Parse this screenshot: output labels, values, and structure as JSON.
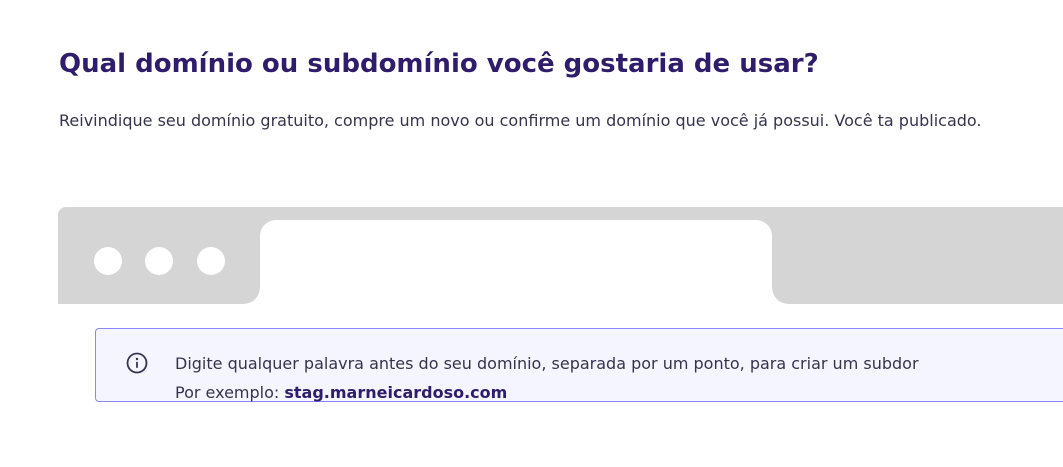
{
  "heading": {
    "title": "Qual domínio ou subdomínio você gostaria de usar?",
    "description": "Reivindique seu domínio gratuito, compre um novo ou confirme um domínio que você já possui. Você ta publicado."
  },
  "browser_mock": {
    "info_alert": {
      "icon": "info-circle-icon",
      "line1": "Digite qualquer palavra antes do seu domínio, separada por um ponto, para criar um subdor",
      "example_prefix": "Por exemplo: ",
      "example_domain": "stag.marneicardoso.com"
    }
  },
  "colors": {
    "title": "#2f1c6a",
    "body_text": "#36344d",
    "browser_bar": "#d5d5d5",
    "alert_background": "#f4f5ff",
    "alert_border": "#8c85ff"
  }
}
